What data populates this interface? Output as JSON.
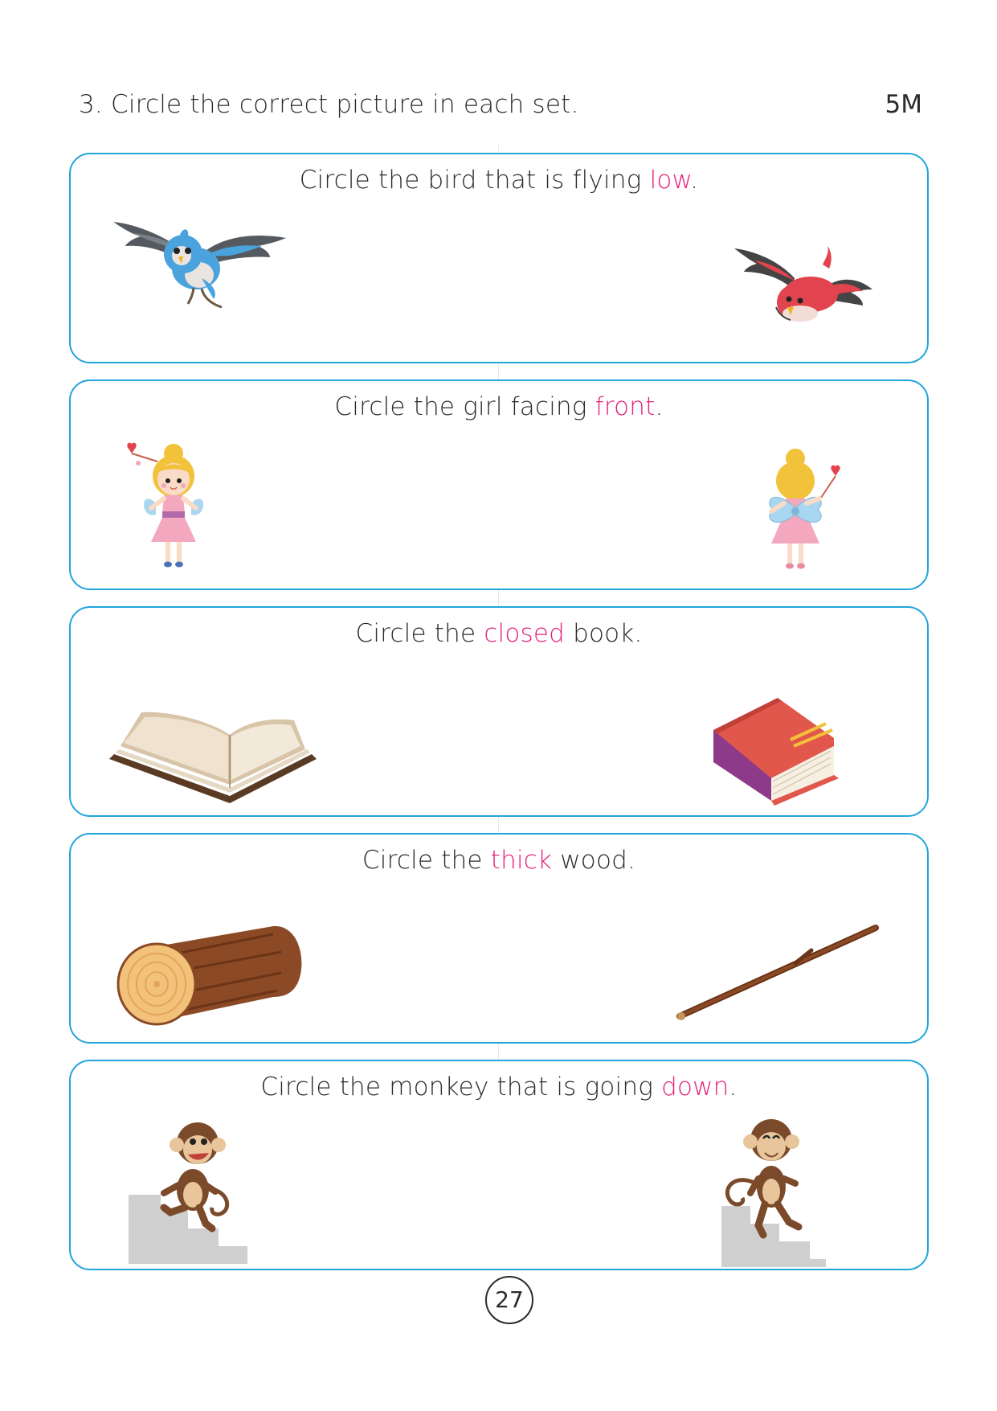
{
  "question": {
    "number": "3.",
    "text": "Circle the correct picture in each set.",
    "marks": "5M"
  },
  "sets": [
    {
      "before": "Circle the bird that is flying ",
      "highlight": "low",
      "after": ".",
      "left_icon": "blue-bird-flying-high",
      "right_icon": "red-bird-flying-low"
    },
    {
      "before": "Circle the girl facing ",
      "highlight": "front",
      "after": ".",
      "left_icon": "fairy-girl-front",
      "right_icon": "fairy-girl-back"
    },
    {
      "before": "Circle the ",
      "highlight": "closed",
      "after": " book.",
      "left_icon": "open-book",
      "right_icon": "closed-book"
    },
    {
      "before": "Circle the ",
      "highlight": "thick",
      "after": " wood.",
      "left_icon": "thick-log",
      "right_icon": "thin-stick"
    },
    {
      "before": "Circle the monkey that is going ",
      "highlight": "down",
      "after": ".",
      "left_icon": "monkey-going-up-stairs",
      "right_icon": "monkey-going-down-stairs"
    }
  ],
  "page_number": "27",
  "colors": {
    "border": "#22a5dd",
    "highlight": "#e6207a",
    "text": "#2b2b2b"
  }
}
